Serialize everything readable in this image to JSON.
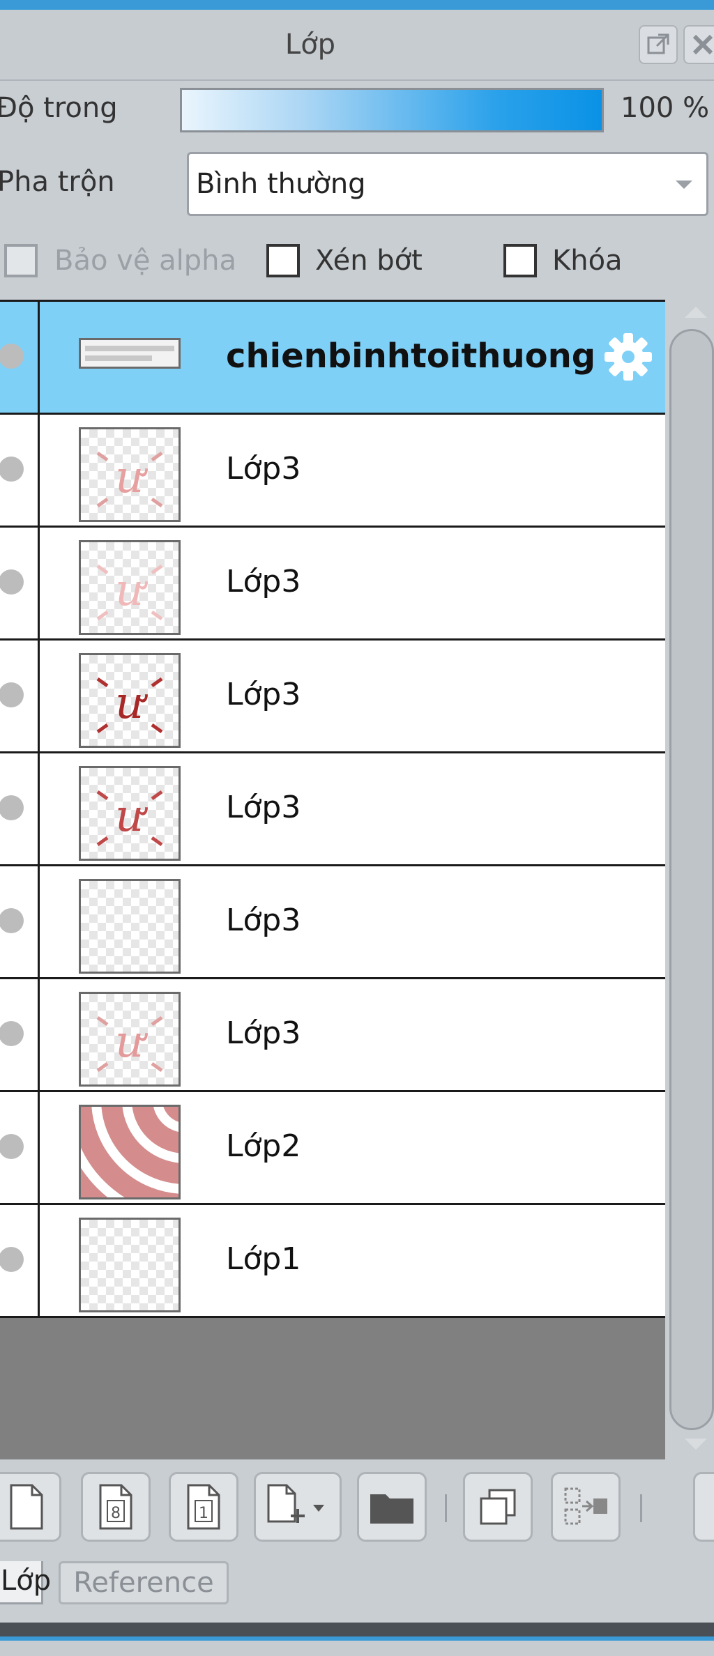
{
  "panel": {
    "title": "Lớp"
  },
  "opacity": {
    "label": "Độ trong",
    "value_text": "100 %",
    "value": 100
  },
  "blend": {
    "label": "Pha trộn",
    "value": "Bình thường"
  },
  "options": {
    "protect_alpha": "Bảo vệ alpha",
    "clip": "Xén bớt",
    "lock": "Khóa"
  },
  "layers": [
    {
      "name": "chienbinhtoithuong",
      "selected": true
    },
    {
      "name": "Lớp3"
    },
    {
      "name": "Lớp3"
    },
    {
      "name": "Lớp3"
    },
    {
      "name": "Lớp3"
    },
    {
      "name": "Lớp3"
    },
    {
      "name": "Lớp3"
    },
    {
      "name": "Lớp2"
    },
    {
      "name": "Lớp1"
    }
  ],
  "toolbar": {
    "new_8bit_label": "8",
    "new_1bit_label": "1"
  },
  "tabs": {
    "active": "Lớp",
    "inactive": "Reference"
  },
  "colors": {
    "accent": "#3a9ad8",
    "selected_row": "#7fd0f7",
    "bar_end": "#0a92e6"
  }
}
